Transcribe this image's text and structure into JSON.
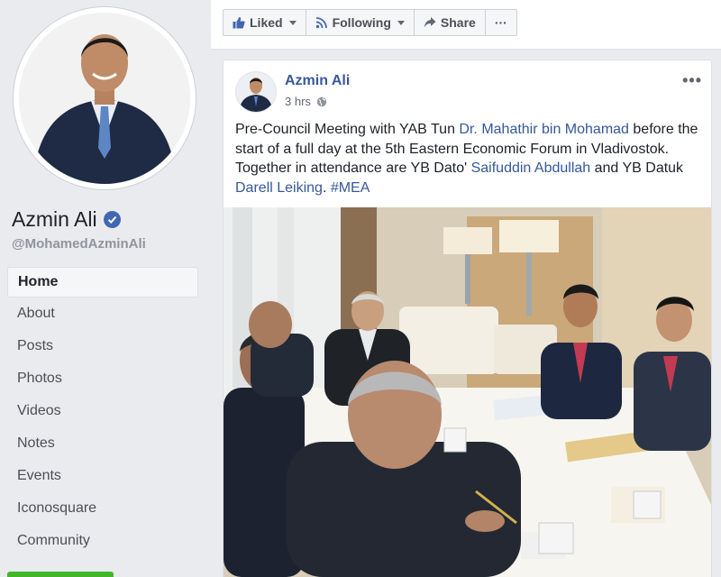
{
  "profile": {
    "name": "Azmin Ali",
    "handle": "@MohamedAzminAli"
  },
  "nav": {
    "items": [
      {
        "label": "Home",
        "active": true
      },
      {
        "label": "About"
      },
      {
        "label": "Posts"
      },
      {
        "label": "Photos"
      },
      {
        "label": "Videos"
      },
      {
        "label": "Notes"
      },
      {
        "label": "Events"
      },
      {
        "label": "Iconosquare"
      },
      {
        "label": "Community"
      }
    ]
  },
  "actions": {
    "liked": "Liked",
    "following": "Following",
    "share": "Share",
    "more": "···"
  },
  "post": {
    "author": "Azmin Ali",
    "time": "3 hrs",
    "more": "•••",
    "text": {
      "t1": "Pre-Council Meeting with YAB Tun ",
      "l1": "Dr. Mahathir bin Mohamad",
      "t2": " before the start of a full day at the 5th Eastern Economic Forum in Vladivostok. Together in attendance are YB Dato' ",
      "l2": "Saifuddin Abdullah",
      "t3": " and YB Datuk ",
      "l3": "Darell Leiking",
      "t4": ". ",
      "l4": "#MEA"
    }
  },
  "colors": {
    "brand_link": "#365899",
    "page_bg": "#e9ebee",
    "verified": "#4267b2"
  }
}
